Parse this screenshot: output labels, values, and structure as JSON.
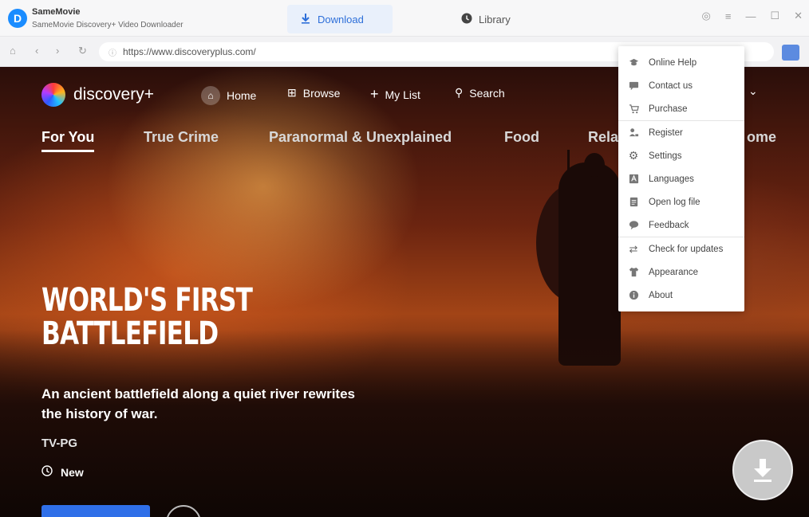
{
  "app": {
    "name": "SameMovie",
    "subtitle": "SameMovie Discovery+ Video Downloader",
    "logo_letter": "D"
  },
  "tabs": {
    "download": "Download",
    "library": "Library"
  },
  "browser": {
    "url": "https://www.discoveryplus.com/"
  },
  "site": {
    "brand": "discovery+",
    "nav": {
      "home": "Home",
      "browse": "Browse",
      "mylist": "My List",
      "search": "Search"
    },
    "categories": [
      "For You",
      "True Crime",
      "Paranormal & Unexplained",
      "Food",
      "Rela",
      "ome"
    ],
    "hero": {
      "title_line1": "WORLD'S FIRST",
      "title_line2": "BATTLEFIELD",
      "description": "An ancient battlefield along a quiet river rewrites the history of war.",
      "rating": "TV-PG",
      "tag": "New"
    }
  },
  "menu": {
    "items": [
      {
        "label": "Online Help",
        "icon": "graduation-cap-icon"
      },
      {
        "label": "Contact us",
        "icon": "chat-icon"
      },
      {
        "label": "Purchase",
        "icon": "cart-icon"
      },
      {
        "label": "Register",
        "icon": "user-key-icon"
      },
      {
        "label": "Settings",
        "icon": "gear-icon"
      },
      {
        "label": "Languages",
        "icon": "translate-icon"
      },
      {
        "label": "Open log file",
        "icon": "file-icon"
      },
      {
        "label": "Feedback",
        "icon": "feedback-icon"
      },
      {
        "label": "Check for updates",
        "icon": "refresh-icon"
      },
      {
        "label": "Appearance",
        "icon": "shirt-icon"
      },
      {
        "label": "About",
        "icon": "info-icon"
      }
    ]
  },
  "colors": {
    "accent": "#2d6fd9",
    "play_button": "#2f6fe8"
  }
}
